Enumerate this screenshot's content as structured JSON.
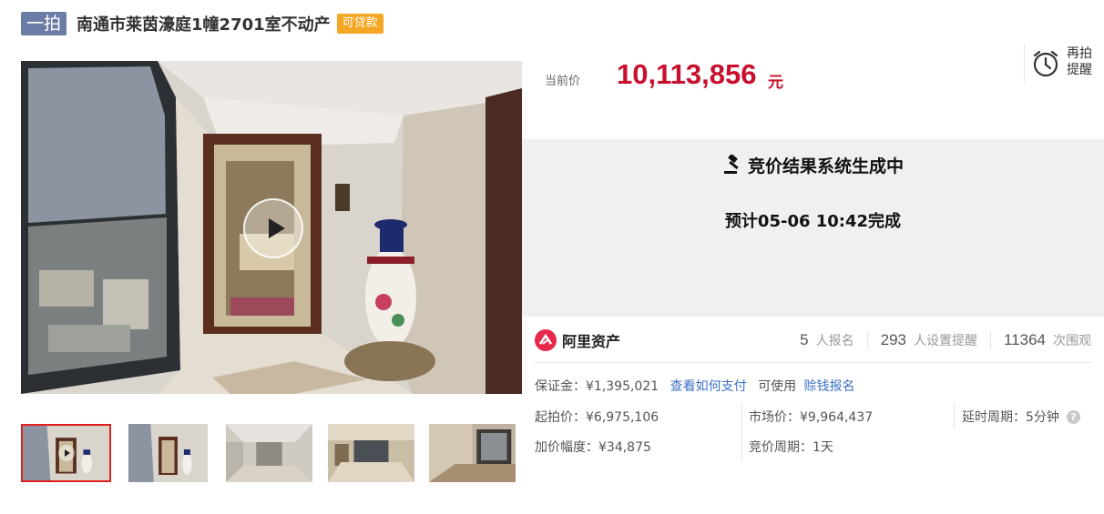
{
  "header": {
    "tag": "一拍",
    "title": "南通市莱茵濠庭1幢2701室不动产",
    "loan_badge": "可贷款"
  },
  "price": {
    "label": "当前价",
    "value": "10,113,856",
    "unit": "元"
  },
  "reminder": {
    "label": "再拍提醒",
    "icon": "alarm-clock-icon"
  },
  "status": {
    "title": "竞价结果系统生成中",
    "subtitle": "预计05-06 10:42完成",
    "icon": "gavel-icon"
  },
  "platform": {
    "name": "阿里资产"
  },
  "stats": [
    {
      "num": "5",
      "label": "人报名"
    },
    {
      "num": "293",
      "label": "人设置提醒"
    },
    {
      "num": "11364",
      "label": "次围观"
    }
  ],
  "details": {
    "deposit_label": "保证金：¥1,395,021",
    "deposit_link": "查看如何支付",
    "usable_text": "可使用",
    "usable_link": "赊钱报名",
    "start_price": "起拍价：¥6,975,106",
    "market_price": "市场价：¥9,964,437",
    "delay_period": "延时周期：5分钟",
    "increment": "加价幅度：¥34,875",
    "bid_period": "竞价周期：1天"
  },
  "colors": {
    "price_red": "#c8102e",
    "tag_blue": "#6b7ca6",
    "badge_orange": "#f5a623",
    "link_blue": "#3a6fc7",
    "thumb_active_border": "#e02020"
  }
}
